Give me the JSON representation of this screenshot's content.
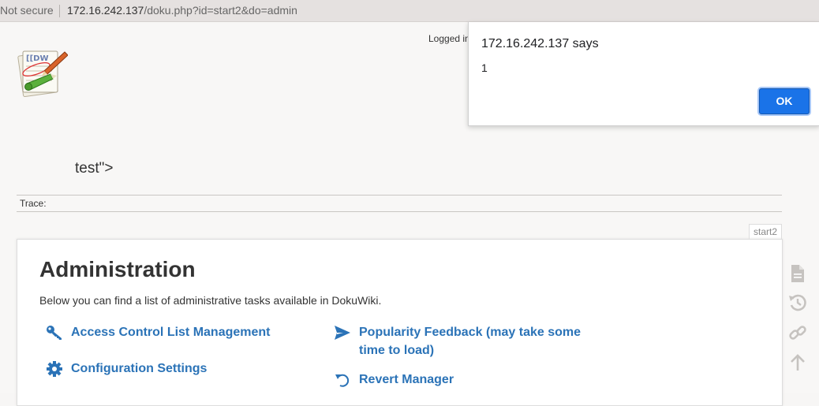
{
  "browser": {
    "security_label": "Not secure",
    "url_host": "172.16.242.137",
    "url_path": "/doku.php?id=start2&do=admin"
  },
  "header": {
    "logged_in_text": "Logged in"
  },
  "injected_text": "test\">",
  "breadcrumbs": {
    "label": "Trace:"
  },
  "page": {
    "id_tab": "start2",
    "title": "Administration",
    "intro": "Below you can find a list of administrative tasks available in DokuWiki.",
    "admin_items": [
      {
        "label": "Access Control List Management",
        "icon": "key-icon"
      },
      {
        "label": "Configuration Settings",
        "icon": "gear-icon"
      },
      {
        "label": "Popularity Feedback (may take some time to load)",
        "icon": "send-icon"
      },
      {
        "label": "Revert Manager",
        "icon": "revert-icon"
      }
    ]
  },
  "page_tools": [
    {
      "name": "show-page-icon"
    },
    {
      "name": "old-revisions-icon"
    },
    {
      "name": "backlinks-icon"
    },
    {
      "name": "back-to-top-icon"
    }
  ],
  "dialog": {
    "title": "172.16.242.137 says",
    "message": "1",
    "ok_label": "OK"
  },
  "colors": {
    "link": "#2b73b7",
    "dialog_button": "#1a73e8"
  }
}
